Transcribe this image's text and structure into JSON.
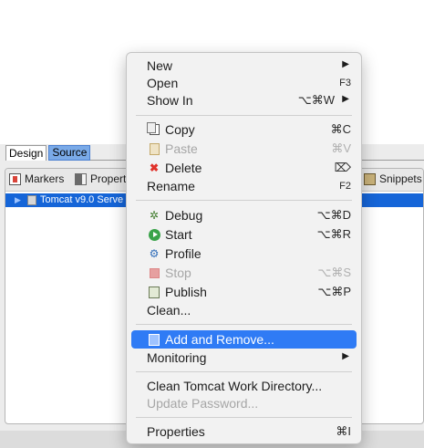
{
  "editor": {
    "tabs": [
      "Design",
      "Source"
    ],
    "active_tab": "Source"
  },
  "views": {
    "tabs": {
      "markers": "Markers",
      "properties": "Propert",
      "snippets": "Snippets"
    },
    "server_row_label": "Tomcat v9.0 Serve"
  },
  "context_menu": {
    "selected_item": "Add and Remove...",
    "items": {
      "new": {
        "label": "New",
        "has_submenu": true
      },
      "open": {
        "label": "Open",
        "shortcut": "F3"
      },
      "show_in": {
        "label": "Show In",
        "shortcut": "⌥⌘W",
        "has_submenu": true
      },
      "copy": {
        "label": "Copy",
        "shortcut": "⌘C",
        "icon": "copy-icon"
      },
      "paste": {
        "label": "Paste",
        "shortcut": "⌘V",
        "icon": "paste-icon",
        "disabled": true
      },
      "delete": {
        "label": "Delete",
        "shortcut": "⌦",
        "icon": "delete-icon"
      },
      "rename": {
        "label": "Rename",
        "shortcut": "F2"
      },
      "debug": {
        "label": "Debug",
        "shortcut": "⌥⌘D",
        "icon": "debug-icon"
      },
      "start": {
        "label": "Start",
        "shortcut": "⌥⌘R",
        "icon": "start-icon"
      },
      "profile": {
        "label": "Profile",
        "icon": "profile-icon"
      },
      "stop": {
        "label": "Stop",
        "shortcut": "⌥⌘S",
        "icon": "stop-icon",
        "disabled": true
      },
      "publish": {
        "label": "Publish",
        "shortcut": "⌥⌘P",
        "icon": "publish-icon"
      },
      "clean": {
        "label": "Clean..."
      },
      "add_remove": {
        "label": "Add and Remove...",
        "icon": "add-remove-icon"
      },
      "monitoring": {
        "label": "Monitoring",
        "has_submenu": true
      },
      "clean_work_dir": {
        "label": "Clean Tomcat Work Directory..."
      },
      "update_password": {
        "label": "Update Password...",
        "disabled": true
      },
      "properties": {
        "label": "Properties",
        "shortcut": "⌘I"
      }
    }
  },
  "colors": {
    "selection": "#2f7bf5",
    "server_row": "#1565d8",
    "source_tab": "#7aaae8"
  }
}
